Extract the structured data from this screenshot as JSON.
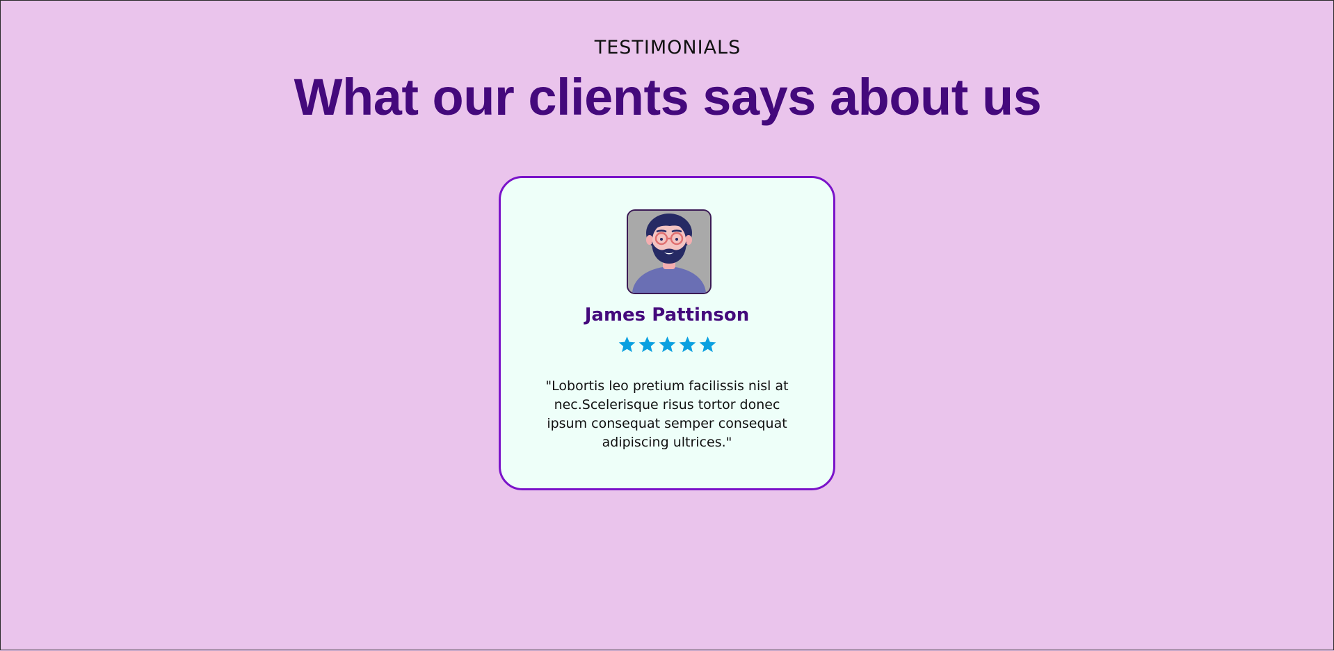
{
  "section": {
    "eyebrow": "TESTIMONIALS",
    "heading": "What our clients says about us"
  },
  "testimonial": {
    "avatar_icon": "bearded-man-avatar",
    "name": "James Pattinson",
    "rating": 5,
    "rating_max": 5,
    "star_color": "#0aa0e0",
    "quote": "\"Lobortis leo pretium facilissis nisl at nec.Scelerisque risus tortor donec ipsum consequat semper consequat adipiscing ultrices.\""
  },
  "colors": {
    "background": "#eac4ec",
    "heading": "#44097c",
    "card_border": "#7a13c9",
    "card_background": "#eefff9"
  }
}
